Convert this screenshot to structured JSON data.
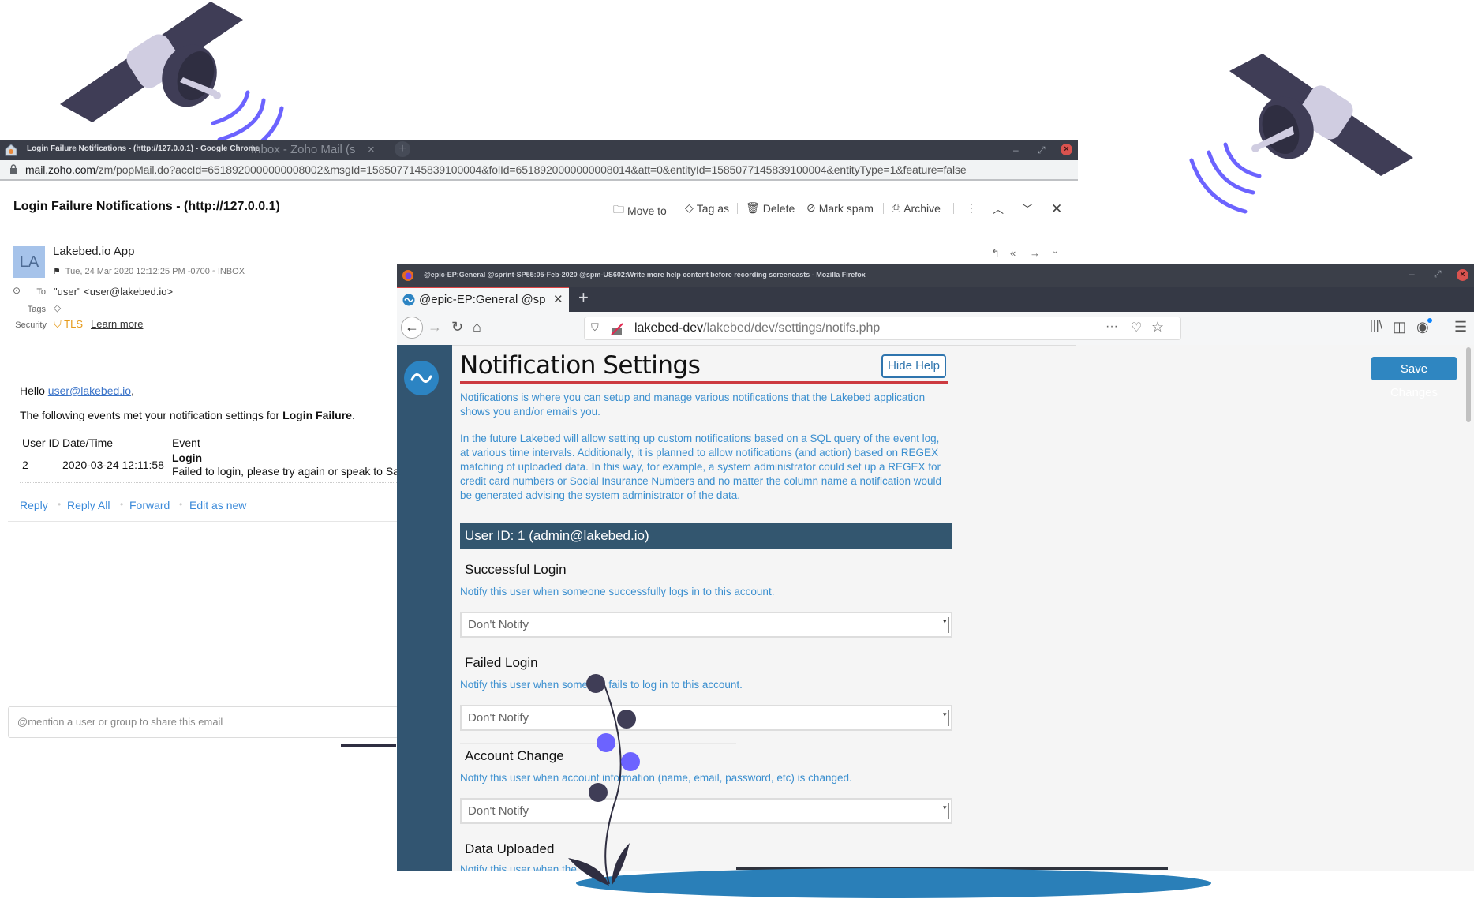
{
  "chrome_window": {
    "title": "Login Failure Notifications - (http://127.0.0.1) - Google Chrome",
    "background_tab": "Inbox - Zoho Mail (s",
    "url_host": "mail.zoho.com",
    "url_path": "/zm/popMail.do?accId=6518920000000008002&msgId=1585077145839100004&folId=6518920000000008014&att=0&entityId=1585077145839100004&entityType=1&feature=false"
  },
  "mail": {
    "subject": "Login Failure Notifications - (http://127.0.0.1)",
    "toolbar": {
      "move_to": "Move to",
      "tag_as": "Tag as",
      "delete": "Delete",
      "mark_spam": "Mark spam",
      "archive": "Archive"
    },
    "avatar_initials": "LA",
    "sender": "Lakebed.io App",
    "date": "Tue, 24 Mar 2020 12:12:25 PM -0700",
    "folder": "INBOX",
    "to_label": "To",
    "to_value": "\"user\" <user@lakebed.io>",
    "tags_label": "Tags",
    "security_label": "Security",
    "security_value": "TLS",
    "learn_more": "Learn more",
    "body": {
      "hello": "Hello",
      "hello_link": "user@lakebed.io",
      "hello_end": ",",
      "following_prefix": "The following events met your notification settings for",
      "following_bold": "Login Failure",
      "following_end": ".",
      "table_headers": [
        "User ID",
        "Date/Time",
        "Event"
      ],
      "rows": [
        {
          "user_id": "2",
          "datetime": "2020-03-24 12:11:58",
          "event_title": "Login",
          "event_desc": "Failed to login, please try again or speak to Sally The IT Admin"
        }
      ]
    },
    "actions": [
      "Reply",
      "Reply All",
      "Forward",
      "Edit as new"
    ],
    "mention_placeholder": "@mention a user or group to share this email"
  },
  "firefox_window": {
    "title": "@epic-EP:General @sprint-SP55:05-Feb-2020 @spm-US602:Write more help content before recording screencasts - Mozilla Firefox",
    "tab_label": "@epic-EP:General @sprint-SP55:05-Feb-2020",
    "url_host": "lakebed-dev",
    "url_path": "/lakebed/dev/settings/notifs.php"
  },
  "notifications_page": {
    "title": "Notification Settings",
    "hide_help": "Hide Help",
    "save_changes": "Save Changes",
    "help_1": "Notifications is where you can setup and manage various notifications that the Lakebed application shows you and/or emails you.",
    "help_2": "In the future Lakebed will allow setting up custom notifications based on a SQL query of the event log, at various time intervals. Additionally, it is planned to allow notifications (and action) based on REGEX matching of uploaded data. In this way, for example, a system administrator could set up a REGEX for credit card numbers or Social Insurance Numbers and no matter the column name a notification would be generated advising the system administrator of the data.",
    "user_bar": "User ID: 1 (admin@lakebed.io)",
    "sections": [
      {
        "title": "Successful Login",
        "desc": "Notify this user when someone successfully logs in to this account.",
        "selected": "Don't Notify"
      },
      {
        "title": "Failed Login",
        "desc": "Notify this user when someone fails to log in to this account.",
        "selected": "Don't Notify"
      },
      {
        "title": "Account Change",
        "desc": "Notify this user when account information (name, email, password, etc) is changed.",
        "selected": "Don't Notify"
      },
      {
        "title": "Data Uploaded",
        "desc": "Notify this user when the...",
        "selected": ""
      }
    ]
  },
  "colors": {
    "accent_blue": "#2f86c1",
    "sidebar": "#325571",
    "title_underline": "#cc3a40",
    "satellite_dark": "#3f3d56",
    "satellite_light": "#d0cde1",
    "signal": "#6c63ff"
  }
}
